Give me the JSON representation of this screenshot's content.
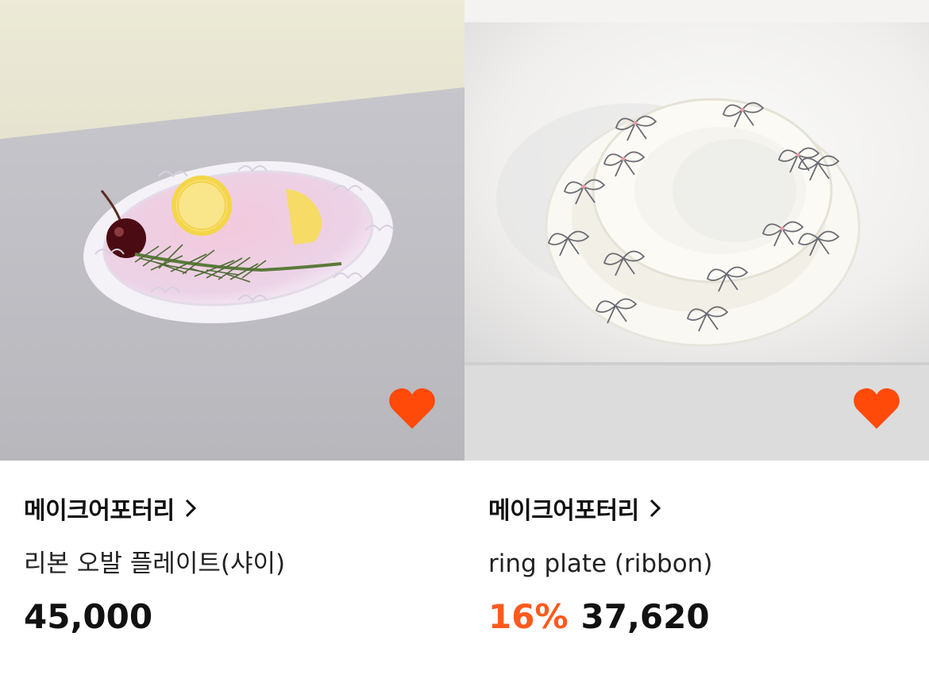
{
  "products": [
    {
      "brand": "메이크어포터리",
      "brand_icon": "chevron-right-icon",
      "title": "리본 오발 플레이트(샤이)",
      "discount": "",
      "price": "45,000",
      "wishlist_icon": "heart-icon",
      "wishlisted": true
    },
    {
      "brand": "메이크어포터리",
      "brand_icon": "chevron-right-icon",
      "title": "ring plate (ribbon)",
      "discount": "16%",
      "price": "37,620",
      "wishlist_icon": "heart-icon",
      "wishlisted": true
    }
  ],
  "colors": {
    "accent": "#ff5a1f",
    "text": "#111111"
  }
}
